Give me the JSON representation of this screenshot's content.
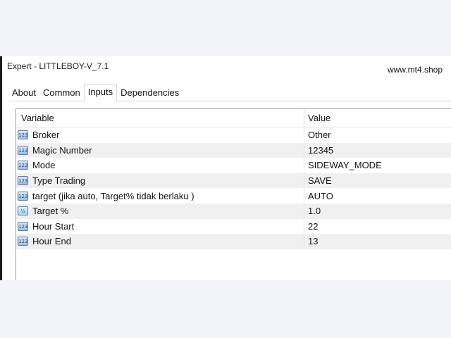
{
  "window": {
    "title": "Expert - LITTLEBOY-V_7.1",
    "watermark": "www.mt4.shop"
  },
  "tabs": [
    {
      "label": "About"
    },
    {
      "label": "Common"
    },
    {
      "label": "Inputs"
    },
    {
      "label": "Dependencies"
    }
  ],
  "active_tab": "Inputs",
  "grid": {
    "headers": {
      "variable": "Variable",
      "value": "Value"
    },
    "rows": [
      {
        "variable": "Broker",
        "value": "Other",
        "icon": "integer-param-icon",
        "icon_text": "123"
      },
      {
        "variable": "Magic Number",
        "value": "12345",
        "icon": "integer-param-icon",
        "icon_text": "123"
      },
      {
        "variable": "Mode",
        "value": "SIDEWAY_MODE",
        "icon": "integer-param-icon",
        "icon_text": "123"
      },
      {
        "variable": "Type Trading",
        "value": "SAVE",
        "icon": "integer-param-icon",
        "icon_text": "123"
      },
      {
        "variable": "target (jika auto, Target% tidak berlaku )",
        "value": "AUTO",
        "icon": "integer-param-icon",
        "icon_text": "123"
      },
      {
        "variable": "Target %",
        "value": "1.0",
        "icon": "double-param-icon",
        "icon_text": "½"
      },
      {
        "variable": "Hour Start",
        "value": "22",
        "icon": "integer-param-icon",
        "icon_text": "123"
      },
      {
        "variable": "Hour End",
        "value": "13",
        "icon": "integer-param-icon",
        "icon_text": "123"
      }
    ]
  }
}
